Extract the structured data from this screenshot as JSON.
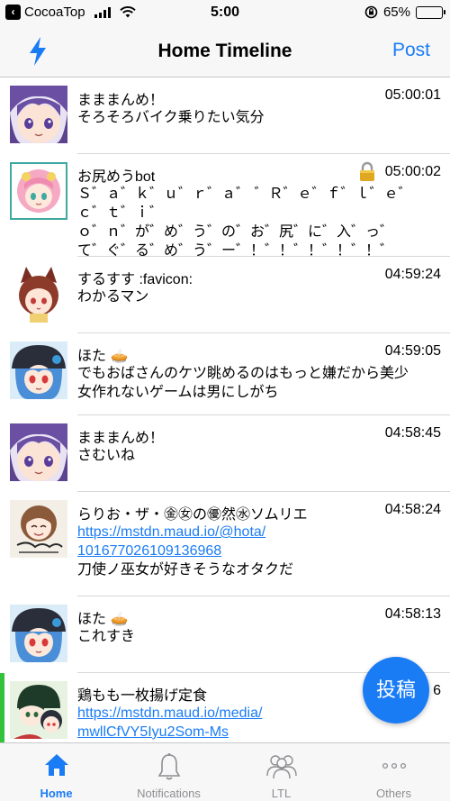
{
  "status_bar": {
    "back_app": "CocoaTop",
    "time": "5:00",
    "battery": "65%",
    "battery_level": 0.65
  },
  "nav": {
    "title": "Home Timeline",
    "post_label": "Post",
    "left_icon": "lightning-bolt-icon"
  },
  "posts": [
    {
      "name": "まままんめ！",
      "time": "05:00:01",
      "lines": [
        "そろそろバイク乗りたい気分"
      ]
    },
    {
      "name": "お尻めうbot",
      "time": "05:00:02",
      "locked": true,
      "lines": [
        "Ｓ゛ａ゛ｋ゛ｕ゛ｒ゛ａ゛ ゛Ｒ゛ｅ゛ｆ゛ｌ゛ｅ゛ｃ゛ｔ゛ｉ゛",
        "ｏ゛ｎ゛が゛め゛う゛の゛お゛尻゛に゛入゛っ゛",
        "て゛ぐ゛る゛め゛う゛ー゛！゛！゛！゛！゛！゛"
      ]
    },
    {
      "name": "するすす :favicon:",
      "time": "04:59:24",
      "lines": [
        "わかるマン"
      ]
    },
    {
      "name": "ほた 🥧",
      "time": "04:59:05",
      "lines": [
        "でもおばさんのケツ眺めるのはもっと嫌だから美少",
        "女作れないゲームは男にしがち"
      ]
    },
    {
      "name": "まままんめ！",
      "time": "04:58:45",
      "lines": [
        "さむいね"
      ]
    },
    {
      "name": "らりお・ザ・㊎㊛の㊝然㊌ソムリエ",
      "time": "04:58:24",
      "link_lines": [
        "https://mstdn.maud.io/@hota/",
        "101677026109136968"
      ],
      "lines": [
        "刀使ノ巫女が好きそうなオタクだ"
      ]
    },
    {
      "name": "ほた 🥧",
      "time": "04:58:13",
      "lines": [
        "これすき"
      ]
    },
    {
      "name": "鶏もも一枚揚げ定食",
      "time": "6",
      "boosted": true,
      "link_lines": [
        "https://mstdn.maud.io/media/",
        "mwllCfVY5Iyu2Som-Ms"
      ],
      "lines": []
    }
  ],
  "fab": {
    "label": "投稿"
  },
  "tabs": [
    {
      "label": "Home",
      "icon": "home-icon",
      "active": true
    },
    {
      "label": "Notifications",
      "icon": "bell-icon",
      "active": false
    },
    {
      "label": "LTL",
      "icon": "people-icon",
      "active": false
    },
    {
      "label": "Others",
      "icon": "more-icon",
      "active": false
    }
  ],
  "colors": {
    "accent": "#1a7cf5",
    "boost": "#33c23b"
  }
}
